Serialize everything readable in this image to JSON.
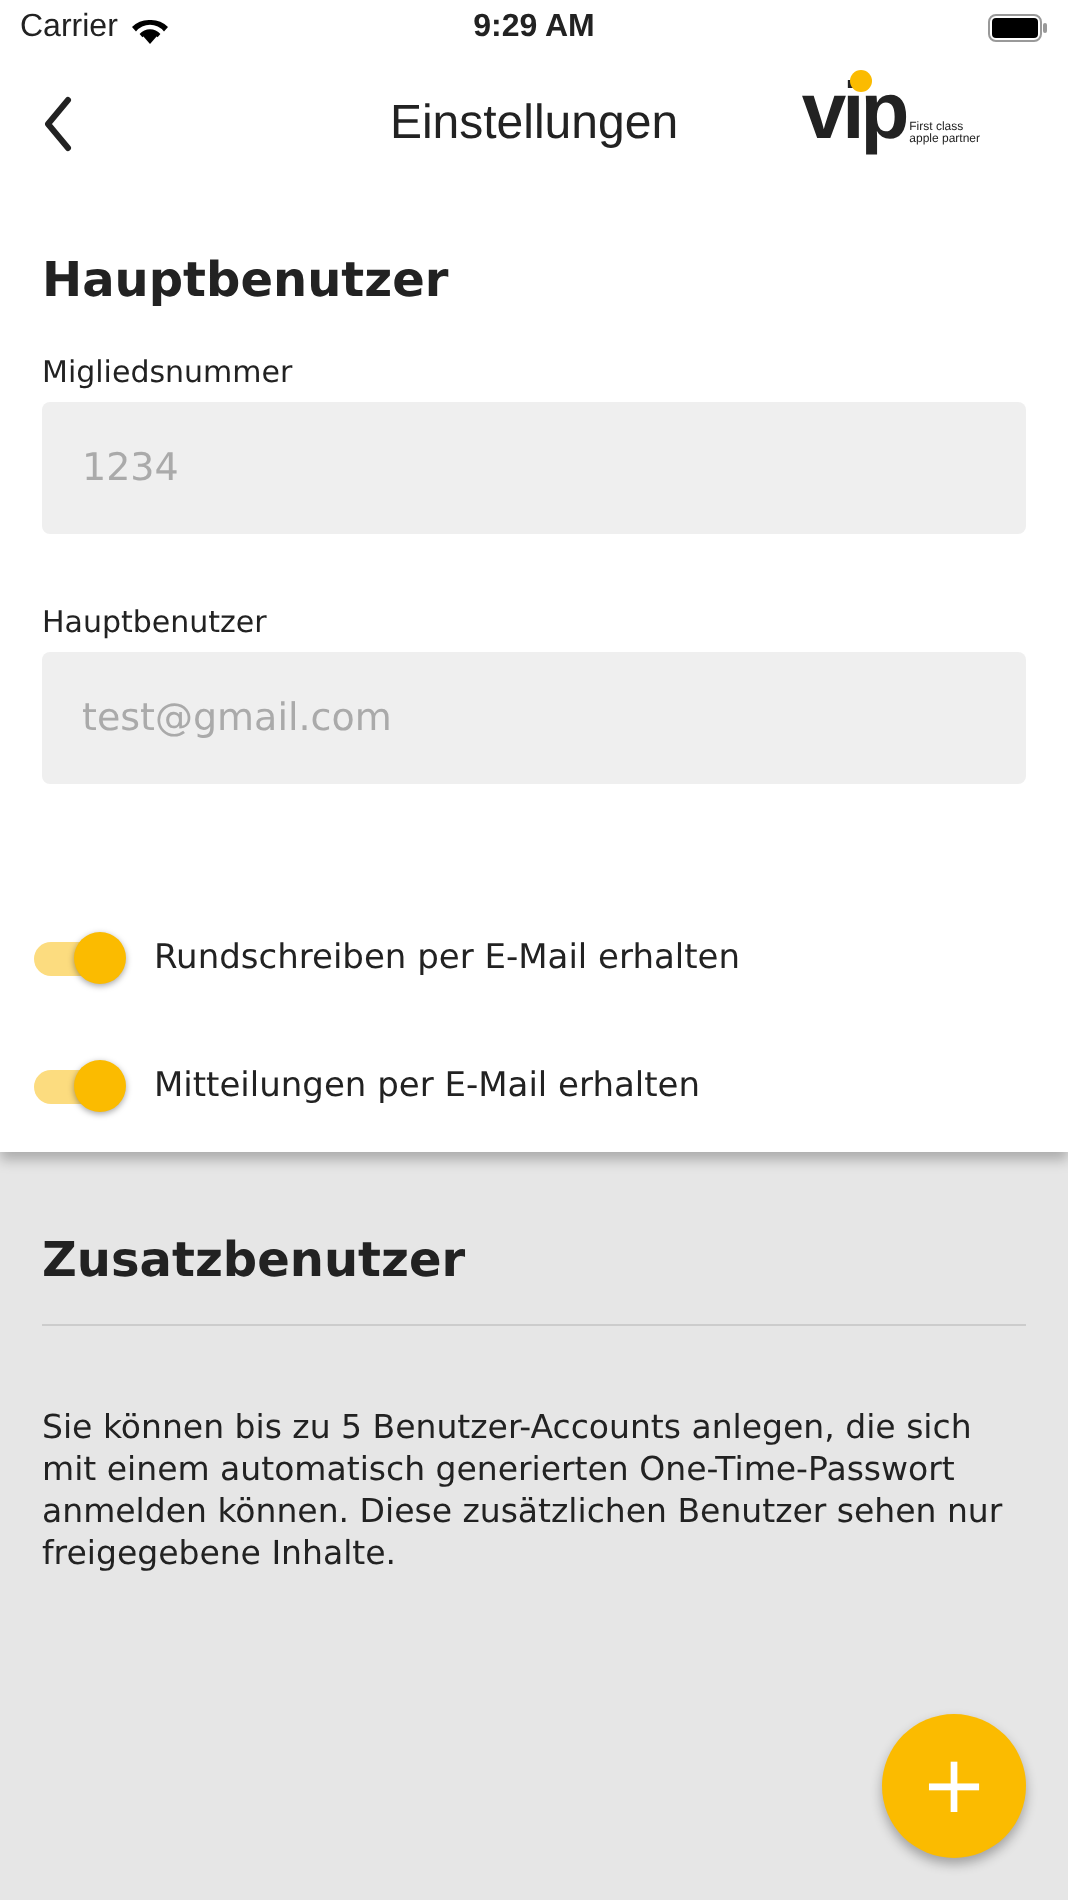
{
  "status_bar": {
    "carrier": "Carrier",
    "time": "9:29 AM"
  },
  "nav": {
    "title": "Einstellungen",
    "logo": {
      "mark": "vip",
      "tagline_1": "First class",
      "tagline_2": "apple partner"
    }
  },
  "main_user": {
    "heading": "Hauptbenutzer",
    "fields": [
      {
        "label": "Migliedsnummer",
        "placeholder": "1234"
      },
      {
        "label": "Hauptbenutzer",
        "placeholder": "test@gmail.com"
      }
    ],
    "toggles": [
      {
        "label": "Rundschreiben per E-Mail erhalten",
        "on": true
      },
      {
        "label": "Mitteilungen per E-Mail erhalten",
        "on": true
      }
    ]
  },
  "extra_users": {
    "heading": "Zusatzbenutzer",
    "text": "Sie können bis zu 5 Benutzer-Accounts anlegen, die sich mit einem automatisch generierten One-Time-Passwort anmelden können. Diese zusätzlichen Benutzer sehen nur freigegebene Inhalte.",
    "add_button": "+"
  }
}
